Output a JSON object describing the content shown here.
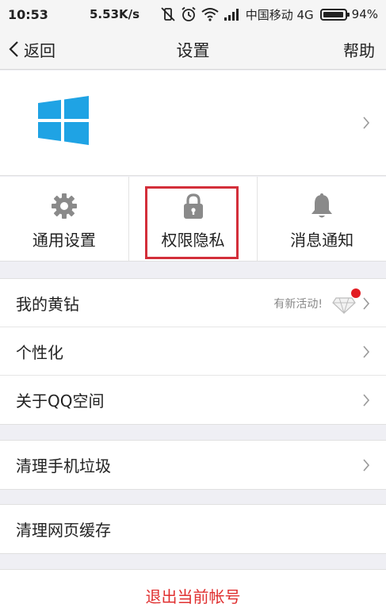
{
  "status_bar": {
    "time": "10:53",
    "net_speed": "5.53K/s",
    "carrier": "中国移动 4G",
    "battery": "94%"
  },
  "nav": {
    "back_label": "返回",
    "title": "设置",
    "help_label": "帮助"
  },
  "profile": {
    "logo_icon": "windows-logo",
    "logo_color": "#1fa3e4"
  },
  "quick_actions": [
    {
      "label": "通用设置",
      "icon": "gear-icon"
    },
    {
      "label": "权限隐私",
      "icon": "lock-icon"
    },
    {
      "label": "消息通知",
      "icon": "bell-icon"
    }
  ],
  "menu": {
    "yellow_diamond": {
      "label": "我的黄钻",
      "promo": "有新活动!"
    },
    "personalize": {
      "label": "个性化"
    },
    "about": {
      "label": "关于QQ空间"
    },
    "clean_phone": {
      "label": "清理手机垃圾"
    },
    "clean_cache": {
      "label": "清理网页缓存"
    }
  },
  "logout_label": "退出当前帐号",
  "colors": {
    "accent_red": "#d32f3a",
    "logout_red": "#e03030",
    "icon_gray": "#8a8a8a"
  }
}
